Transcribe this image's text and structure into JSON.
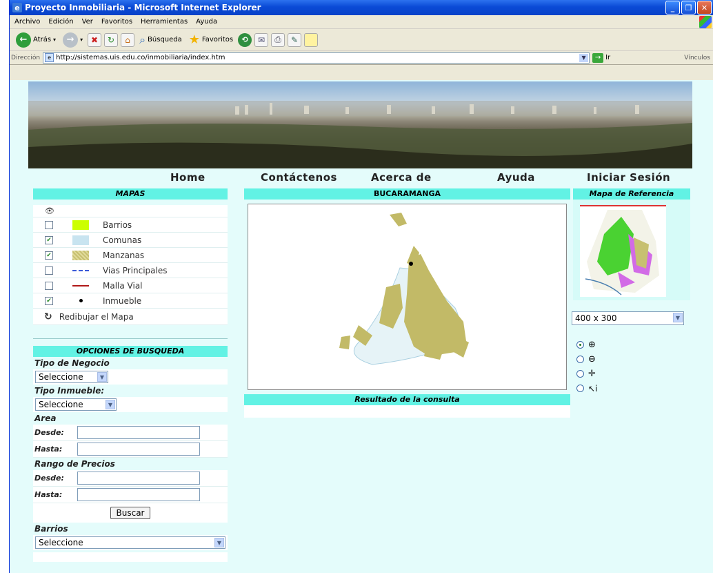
{
  "window": {
    "title": "Proyecto Inmobiliaria - Microsoft Internet Explorer"
  },
  "menu": [
    "Archivo",
    "Edición",
    "Ver",
    "Favoritos",
    "Herramientas",
    "Ayuda"
  ],
  "toolbar": {
    "back": "Atrás",
    "search": "Búsqueda",
    "favorites": "Favoritos"
  },
  "address": {
    "label": "Dirección",
    "url": "http://sistemas.uis.edu.co/inmobiliaria/index.htm",
    "go": "Ir",
    "links": "Vínculos"
  },
  "nav": {
    "home": "Home",
    "contact": "Contáctenos",
    "about": "Acerca de",
    "help": "Ayuda",
    "login": "Iniciar Sesión"
  },
  "mapas": {
    "title": "MAPAS",
    "layers": [
      {
        "label": "Barrios",
        "checked": false,
        "color": "#ccff00"
      },
      {
        "label": "Comunas",
        "checked": true,
        "color": "#c8e4f0"
      },
      {
        "label": "Manzanas",
        "checked": true,
        "color": "#c7c070"
      },
      {
        "label": "Vias Principales",
        "checked": false,
        "color": "#3a5ad8"
      },
      {
        "label": "Malla Vial",
        "checked": false,
        "color": "#b01818"
      },
      {
        "label": "Inmueble",
        "checked": true,
        "color": "#000000"
      }
    ],
    "redraw": "Redibujar el Mapa"
  },
  "search": {
    "title": "OPCIONES DE BUSQUEDA",
    "tipo_negocio": "Tipo de Negocio",
    "tipo_inmueble": "Tipo Inmueble:",
    "select_default": "Seleccione",
    "area": "Area",
    "desde": "Desde:",
    "hasta": "Hasta:",
    "rango": "Rango de Precios",
    "buscar": "Buscar",
    "barrios": "Barrios"
  },
  "map": {
    "title": "BUCARAMANGA",
    "results": "Resultado de la consulta"
  },
  "reference": {
    "title": "Mapa de Referencia",
    "size": "400 x 300",
    "tools": [
      "zoom-in",
      "zoom-out",
      "pan",
      "identify"
    ],
    "selected_tool": "zoom-in"
  }
}
